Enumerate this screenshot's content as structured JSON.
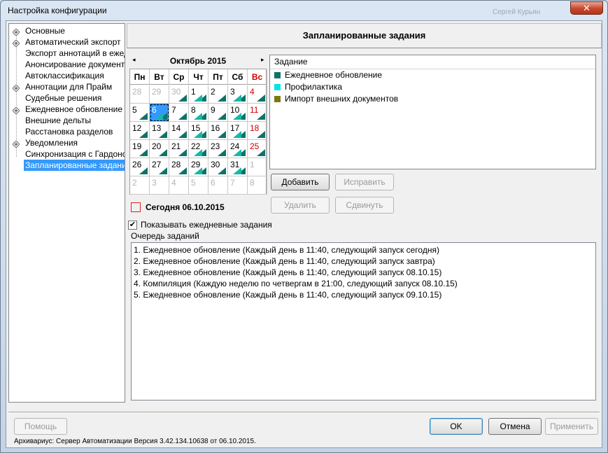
{
  "window": {
    "title": "Настройка конфигурации",
    "ghost_text": "Сергей Курьян",
    "close_label": "✕"
  },
  "tree": {
    "items": [
      {
        "label": "Основные",
        "expandable": true
      },
      {
        "label": "Автоматический экспорт",
        "expandable": true
      },
      {
        "label": "Экспорт аннотаций в ежедневное",
        "expandable": false
      },
      {
        "label": "Анонсирование документов",
        "expandable": false
      },
      {
        "label": "Автоклассификация",
        "expandable": false
      },
      {
        "label": "Аннотации для Прайм",
        "expandable": true
      },
      {
        "label": "Судебные решения",
        "expandable": false
      },
      {
        "label": "Ежедневное обновление",
        "expandable": true
      },
      {
        "label": "Внешние дельты",
        "expandable": false
      },
      {
        "label": "Расстановка разделов",
        "expandable": false
      },
      {
        "label": "Уведомления",
        "expandable": true
      },
      {
        "label": "Синхронизация с Гардоном",
        "expandable": false
      },
      {
        "label": "Запланированные задания",
        "expandable": false,
        "selected": true
      }
    ]
  },
  "header": {
    "title": "Запланированные задания"
  },
  "calendar": {
    "month_label": "Октябрь 2015",
    "prev_label": "◂",
    "next_label": "▸",
    "weekdays": [
      "Пн",
      "Вт",
      "Ср",
      "Чт",
      "Пт",
      "Сб",
      "Вс"
    ],
    "weeks": [
      [
        "28",
        "29",
        "30",
        "1",
        "2",
        "3",
        "4"
      ],
      [
        "5",
        "6",
        "7",
        "8",
        "9",
        "10",
        "11"
      ],
      [
        "12",
        "13",
        "14",
        "15",
        "16",
        "17",
        "18"
      ],
      [
        "19",
        "20",
        "21",
        "22",
        "23",
        "24",
        "25"
      ],
      [
        "26",
        "27",
        "28",
        "29",
        "30",
        "31",
        "1"
      ],
      [
        "2",
        "3",
        "4",
        "5",
        "6",
        "7",
        "8"
      ]
    ],
    "today_label": "Сегодня 06.10.2015",
    "today_color": "#dd2222",
    "selected_color": "#3399ff"
  },
  "tasks": {
    "header": "Задание",
    "items": [
      {
        "label": "Ежедневное обновление",
        "color": "#0d7368"
      },
      {
        "label": "Профилактика",
        "color": "#00e5e5"
      },
      {
        "label": "Импорт внешних документов",
        "color": "#7a7a10"
      }
    ]
  },
  "buttons": {
    "add": "Добавить",
    "edit": "Исправить",
    "delete": "Удалить",
    "move": "Сдвинуть",
    "help": "Помощь",
    "ok": "OK",
    "cancel": "Отмена",
    "apply": "Применить"
  },
  "show_daily": {
    "label": "Показывать ежедневные задания",
    "checked": true,
    "mark": "✔"
  },
  "queue": {
    "label": "Очередь заданий",
    "items": [
      "1. Ежедневное обновление (Каждый день в 11:40, следующий запуск сегодня)",
      "2. Ежедневное обновление (Каждый день в 11:40, следующий запуск завтра)",
      "3. Ежедневное обновление (Каждый день в 11:40, следующий запуск 08.10.15)",
      "4. Компиляция (Каждую неделю по четвергам в 21:00, следующий запуск 08.10.15)",
      "5. Ежедневное обновление (Каждый день в 11:40, следующий запуск 09.10.15)"
    ]
  },
  "status": "Архивариус: Сервер Автоматизации Версия 3.42.134.10638 от 06.10.2015."
}
